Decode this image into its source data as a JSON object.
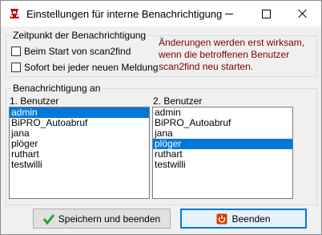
{
  "window": {
    "title": "Einstellungen für interne Benachrichtigung"
  },
  "trigger_group": {
    "legend": "Zeitpunkt der Benachrichtigung",
    "checkbox_start": "Beim Start von scan2find",
    "checkbox_each": "Sofort bei jeder neuen Meldung",
    "note": "Änderungen werden erst wirksam, wenn die betroffenen Benutzer scan2find neu starten."
  },
  "notify_group": {
    "legend": "Benachrichtigung an",
    "user1": {
      "label": "1. Benutzer",
      "items": [
        "admin",
        "BiPRO_Autoabruf",
        "jana",
        "plöger",
        "ruthart",
        "testwilli"
      ],
      "selected_index": 0
    },
    "user2": {
      "label": "2. Benutzer",
      "items": [
        "admin",
        "BiPRO_Autoabruf",
        "jana",
        "plöger",
        "ruthart",
        "testwilli"
      ],
      "selected_index": 3
    }
  },
  "buttons": {
    "save": "Speichern und beenden",
    "quit": "Beenden"
  },
  "colors": {
    "selection": "#0078d7",
    "note_text": "#800000",
    "save_icon": "#2e9d2e",
    "quit_icon": "#d83b01"
  },
  "icons": {
    "app": "app-icon",
    "save": "checkmark-icon",
    "quit": "power-icon"
  }
}
